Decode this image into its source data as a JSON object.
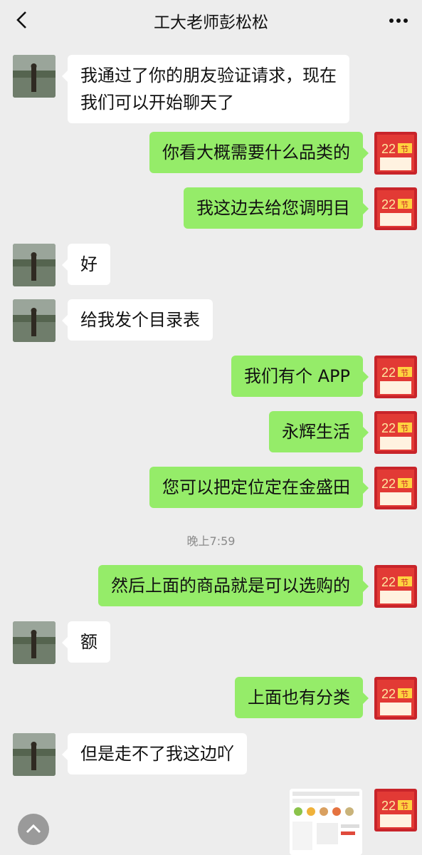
{
  "header": {
    "title": "工大老师彭松松",
    "back_icon": "back-chevron-icon",
    "more_icon": "more-dots-icon"
  },
  "messages": [
    {
      "side": "left",
      "lines": [
        "我通过了你的朋友验证请求，现在",
        "我们可以开始聊天了"
      ]
    },
    {
      "side": "right",
      "text": "你看大概需要什么品类的"
    },
    {
      "side": "right",
      "text": "我这边去给您调明目"
    },
    {
      "side": "left",
      "text": "好"
    },
    {
      "side": "left",
      "text": "给我发个目录表"
    },
    {
      "side": "right",
      "text": "我们有个 APP"
    },
    {
      "side": "right",
      "text": "永辉生活"
    },
    {
      "side": "right",
      "text": "您可以把定位定在金盛田"
    },
    {
      "side": "time",
      "text": "晚上7:59"
    },
    {
      "side": "right",
      "text": "然后上面的商品就是可以选购的"
    },
    {
      "side": "left",
      "text": "额"
    },
    {
      "side": "right",
      "text": "上面也有分类"
    },
    {
      "side": "left",
      "text": "但是走不了我这边吖"
    },
    {
      "side": "right",
      "type": "image"
    }
  ],
  "avatar_right": {
    "big_number": "22",
    "badge": "节"
  },
  "colors": {
    "background": "#ededed",
    "bubble_right": "#95ec69",
    "bubble_left": "#ffffff",
    "avatar_right": "#c8242a"
  },
  "scroll_icon": "chevron-up-icon"
}
